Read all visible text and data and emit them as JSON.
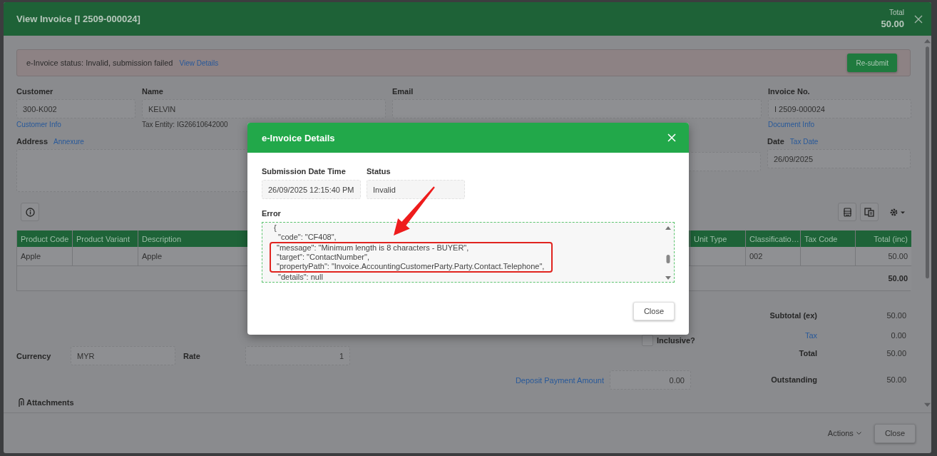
{
  "window": {
    "title": "View Invoice [I 2509-000024]",
    "total_label": "Total",
    "total": "50.00"
  },
  "alert": {
    "text": "e-Invoice status: Invalid, submission failed",
    "link": "View Details",
    "button": "Re-submit"
  },
  "fields": [
    {
      "label": "Customer",
      "value": "300-K002",
      "link": "Customer Info"
    },
    {
      "label": "Name",
      "value": "KELVIN",
      "note": "Tax Entity: IG26610642000"
    },
    {
      "label": "Email"
    },
    {
      "label": "Invoice No.",
      "value": "I 2509-000024",
      "link": "Document Info"
    }
  ],
  "address": {
    "label": "Address",
    "link": "Annexure"
  },
  "date": {
    "label": "Date",
    "link": "Tax Date",
    "value": "26/09/2025"
  },
  "table": {
    "columns": [
      "Product Code",
      "Product Variant",
      "Description",
      "Unit Type",
      "Classificatio…",
      "Tax Code",
      "Total (inc)"
    ],
    "rows": [
      [
        "Apple",
        null,
        "Apple",
        null,
        "002",
        null,
        "50.00"
      ]
    ],
    "total": "50.00"
  },
  "inclusive": {
    "label": "Inclusive?",
    "checked": false
  },
  "currency": {
    "label": "Currency",
    "value": "MYR"
  },
  "rate": {
    "label": "Rate",
    "value": "1"
  },
  "deposit": {
    "label": "Deposit Payment Amount",
    "value": "0.00"
  },
  "summary": [
    {
      "label": "Subtotal (ex)",
      "value": "50.00",
      "kind": "text"
    },
    {
      "label": "Tax",
      "value": "0.00",
      "kind": "link"
    },
    {
      "label": "Total",
      "value": "50.00",
      "kind": "text"
    },
    {
      "label": "Outstanding",
      "value": "50.00",
      "kind": "text"
    }
  ],
  "attachments": {
    "label": "Attachments"
  },
  "footer": {
    "actions": "Actions",
    "close": "Close"
  },
  "dialog": {
    "title": "e-Invoice Details",
    "fields": [
      {
        "label": "Submission Date Time",
        "value": "26/09/2025 12:15:40 PM"
      },
      {
        "label": "Status",
        "value": "Invalid"
      }
    ],
    "error_label": "Error",
    "error_lines": [
      {
        "text": "{",
        "kind": "brace",
        "highlighted": false
      },
      {
        "text": "\"code\": \"CF408\",",
        "kind": "entry",
        "highlighted": false
      },
      {
        "text": "\"message\": \"Minimum length is 8 characters - BUYER\",",
        "kind": "entry",
        "highlighted": true
      },
      {
        "text": "\"target\": \"ContactNumber\",",
        "kind": "entry",
        "highlighted": true
      },
      {
        "text": "\"propertyPath\": \"Invoice.AccountingCustomerParty.Party.Contact.Telephone\",",
        "kind": "entry",
        "highlighted": true
      },
      {
        "text": "\"details\": null",
        "kind": "entry",
        "highlighted": false
      }
    ],
    "close": "Close"
  }
}
